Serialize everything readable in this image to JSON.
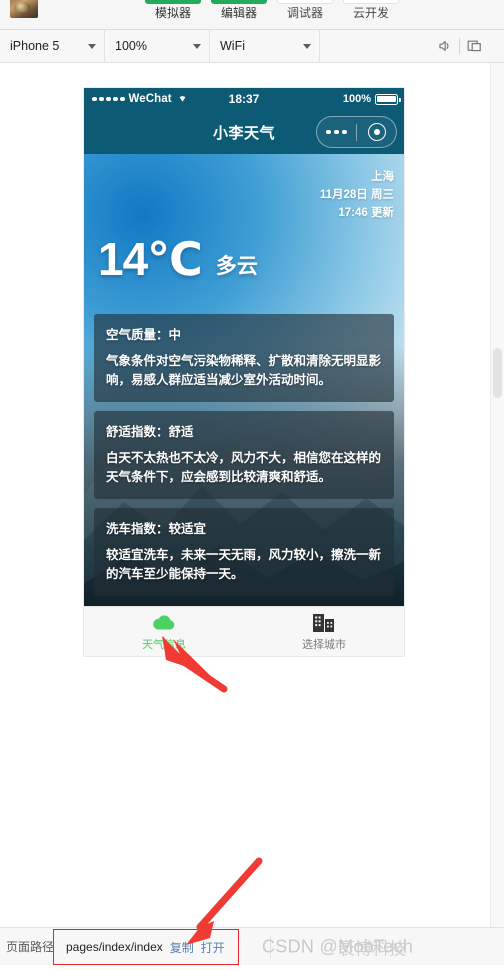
{
  "ide": {
    "nav_items": [
      {
        "label": "模拟器",
        "active": true
      },
      {
        "label": "编辑器",
        "active": true
      },
      {
        "label": "调试器",
        "active": false
      },
      {
        "label": "云开发",
        "active": false
      }
    ],
    "toolbar": {
      "device": "iPhone 5",
      "zoom": "100%",
      "network": "WiFi",
      "mute_icon": "speaker-icon",
      "panel_icon": "window-panel-icon"
    }
  },
  "phone": {
    "statusbar": {
      "carrier": "WeChat",
      "wifi_glyph": "⇧",
      "time": "18:37",
      "battery_percent": "100%"
    },
    "navbar": {
      "title": "小李天气",
      "more_icon": "more-dots-icon",
      "target_icon": "target-circle-icon"
    },
    "weather": {
      "city": "上海",
      "date": "11月28日 周三",
      "updated": "17:46 更新",
      "temperature": "14℃",
      "condition": "多云",
      "cards": [
        {
          "title": "空气质量：中",
          "body": "气象条件对空气污染物稀释、扩散和清除无明显影响，易感人群应适当减少室外活动时间。"
        },
        {
          "title": "舒适指数：舒适",
          "body": "白天不太热也不太冷，风力不大，相信您在这样的天气条件下，应会感到比较清爽和舒适。"
        },
        {
          "title": "洗车指数：较适宜",
          "body": "较适宜洗车，未来一天无雨，风力较小，擦洗一新的汽车至少能保持一天。"
        }
      ]
    },
    "tabbar": [
      {
        "label": "天气信息",
        "icon": "cloud-icon",
        "active": true
      },
      {
        "label": "选择城市",
        "icon": "buildings-icon",
        "active": false
      }
    ]
  },
  "bottombar": {
    "path_label": "页面路径",
    "path_value": "pages/index/index",
    "copy_label": "复制",
    "open_label": "打开",
    "watermark": "CSDN @MobTech",
    "watermark2": "袤博科技"
  },
  "colors": {
    "accent_green": "#21ab5a",
    "tab_active": "#4bd264",
    "header_teal": "#0d5a74",
    "annotation_red": "#e8252a"
  }
}
